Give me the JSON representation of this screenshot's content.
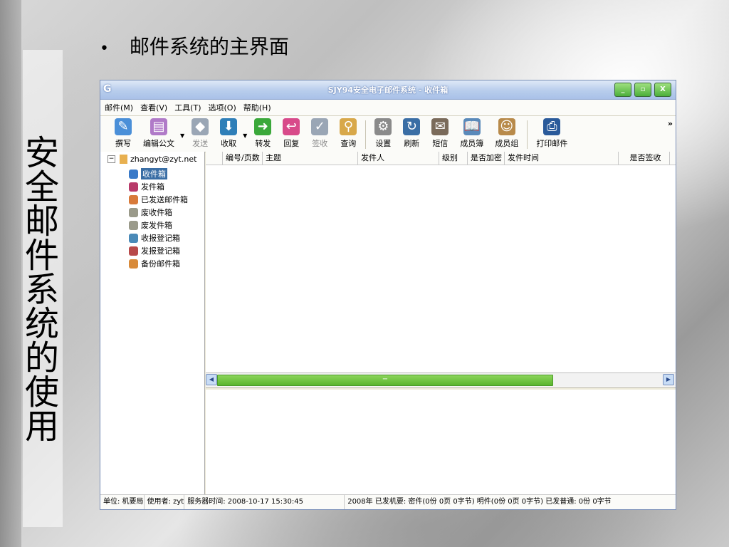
{
  "slide": {
    "vertical_title": "安全邮件系统的使用",
    "bullet": "•",
    "bullet_text": "邮件系统的主界面"
  },
  "window": {
    "title": "SJY94安全电子邮件系统 - 收件箱",
    "app_icon": "G",
    "controls": [
      "_",
      "▫",
      "X"
    ]
  },
  "menu": [
    "邮件(M)",
    "查看(V)",
    "工具(T)",
    "选项(O)",
    "帮助(H)"
  ],
  "toolbar": {
    "compose": "撰写",
    "edit_doc": "编辑公文",
    "send": "发送",
    "receive": "收取",
    "forward": "转发",
    "reply": "回复",
    "sign": "签收",
    "search": "查询",
    "settings": "设置",
    "refresh": "刷新",
    "sms": "短信",
    "members": "成员簿",
    "groups": "成员组",
    "print": "打印邮件",
    "more": "»"
  },
  "tree": {
    "root": "zhangyt@zyt.net",
    "items": [
      "收件箱",
      "发件箱",
      "已发送邮件箱",
      "废收件箱",
      "废发件箱",
      "收报登记箱",
      "发报登记箱",
      "备份邮件箱"
    ]
  },
  "columns": [
    "编号/页数",
    "主题",
    "发件人",
    "级别",
    "是否加密",
    "发件时间",
    "是否签收"
  ],
  "status": {
    "unit": "单位: 机要局",
    "user": "使用者: zyt",
    "server_time": "服务器时间: 2008-10-17 15:30:45",
    "summary": "2008年  已发机要: 密件(0份 0页 0字节) 明件(0份 0页 0字节)  已发普通: 0份 0字节"
  },
  "colors": {
    "selected": "#3a6ea5",
    "scroll_thumb": "#5ab52e"
  }
}
